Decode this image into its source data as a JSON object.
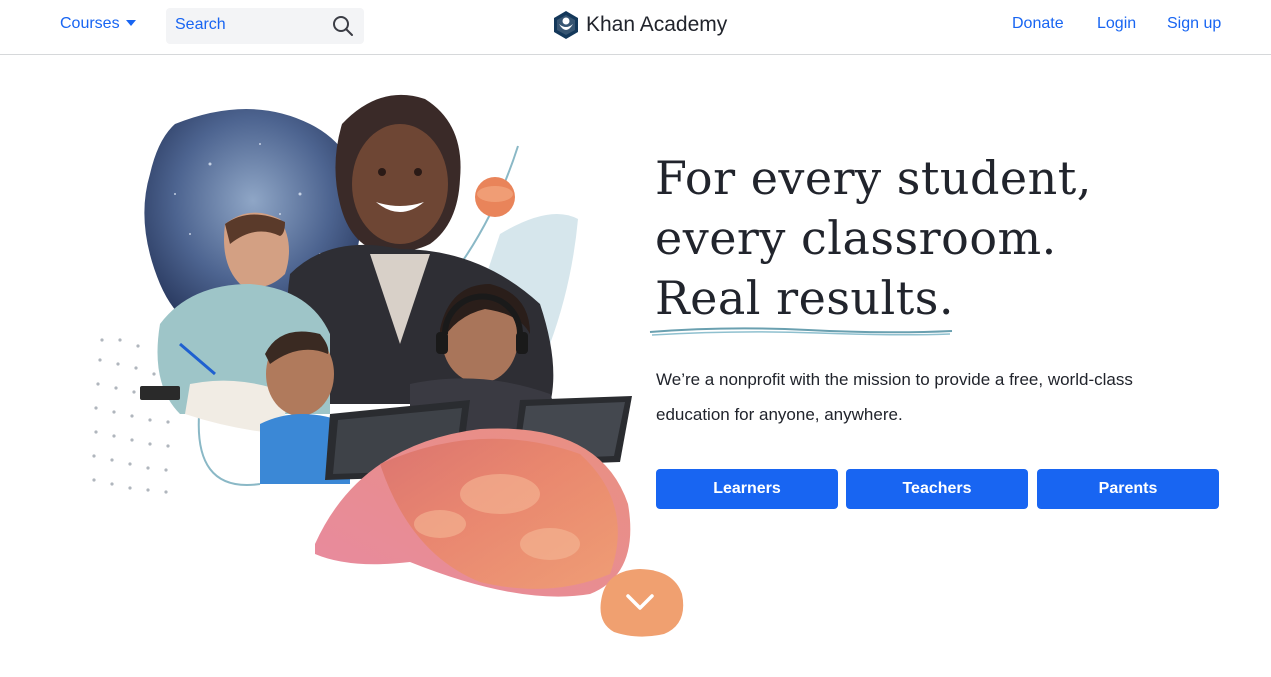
{
  "header": {
    "courses_label": "Courses",
    "search_placeholder": "Search",
    "logo_text": "Khan Academy",
    "donate_label": "Donate",
    "login_label": "Login",
    "signup_label": "Sign up"
  },
  "hero": {
    "headline_lines": [
      "For every student,",
      "every classroom.",
      "Real results."
    ],
    "subtext": "We’re a nonprofit with the mission to provide a free, world-class education for anyone, anywhere.",
    "buttons": [
      {
        "label": "Learners"
      },
      {
        "label": "Teachers"
      },
      {
        "label": "Parents"
      }
    ]
  },
  "icons": {
    "search": "search-icon",
    "caret": "chevron-down-icon",
    "logo": "khan-academy-logo-icon",
    "scroll": "chevron-down-icon"
  },
  "colors": {
    "brand_blue": "#1865f2",
    "text_dark": "#21242c",
    "accent_orange": "#f0a070",
    "underline_teal": "#6aa0b0"
  }
}
